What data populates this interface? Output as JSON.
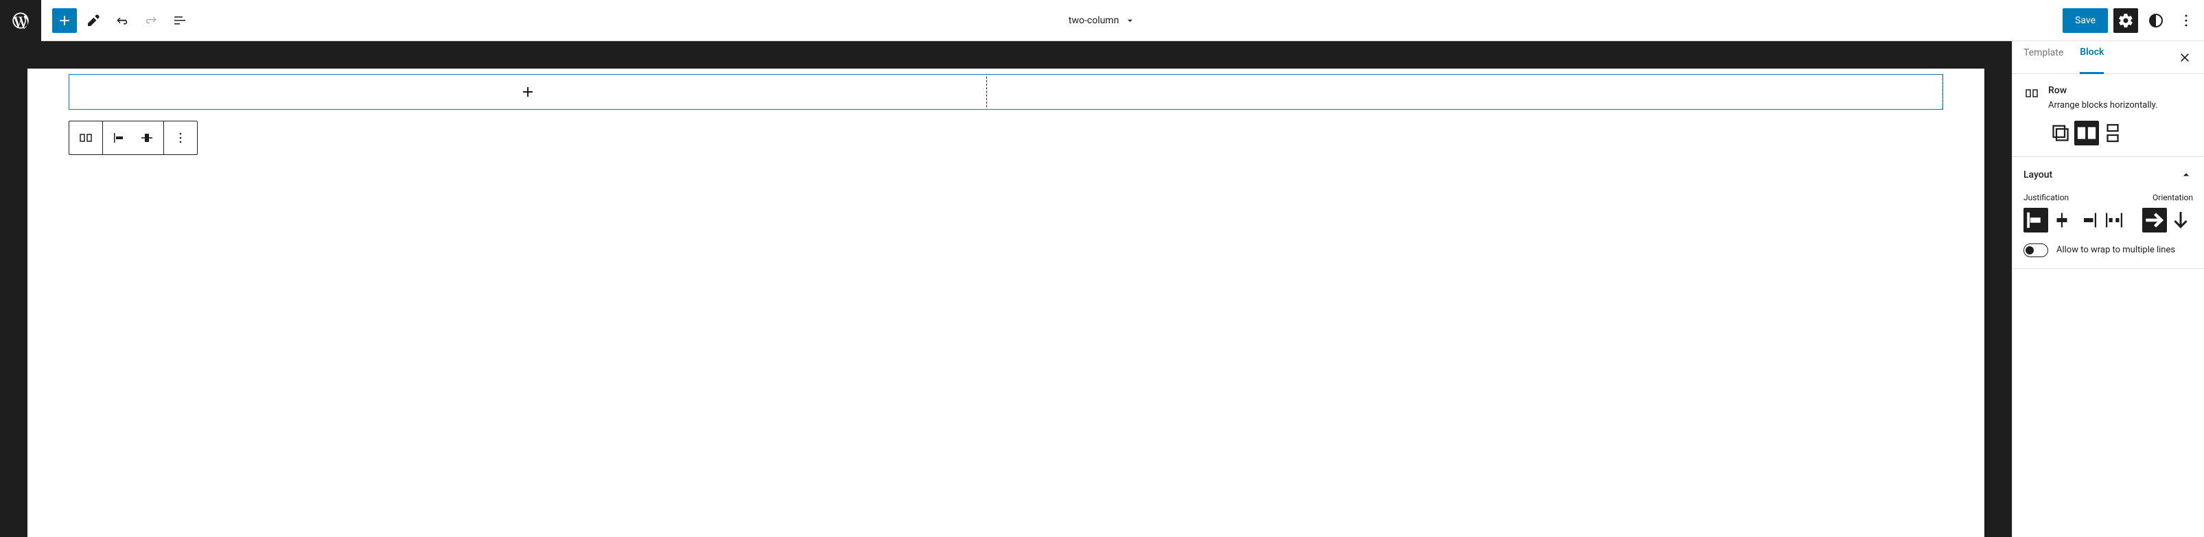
{
  "header": {
    "doc_title": "two-column",
    "save_label": "Save"
  },
  "sidebar": {
    "tabs": {
      "template": "Template",
      "block": "Block"
    },
    "block": {
      "name": "Row",
      "desc": "Arrange blocks horizontally."
    },
    "layout": {
      "title": "Layout",
      "justification_label": "Justification",
      "orientation_label": "Orientation",
      "wrap_label": "Allow to wrap to multiple lines",
      "wrap_on": false
    }
  }
}
